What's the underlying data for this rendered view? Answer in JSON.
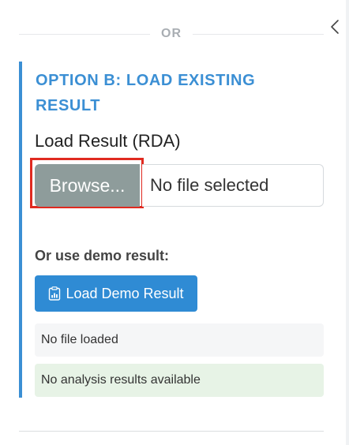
{
  "divider": {
    "text": "OR"
  },
  "option_b": {
    "title": "OPTION B: LOAD EXISTING RESULT",
    "file_field": {
      "label": "Load Result (RDA)",
      "browse_label": "Browse...",
      "value": "No file selected"
    },
    "demo": {
      "label": "Or use demo result:",
      "button_label": "Load Demo Result"
    },
    "status": {
      "file": "No file loaded",
      "analysis": "No analysis results available"
    }
  },
  "icons": {
    "collapse": "chevron-left-icon",
    "demo": "clipboard-chart-icon"
  },
  "colors": {
    "accent": "#3b8fd4",
    "browse_bg": "#8e9c9b",
    "highlight": "#e02a20",
    "demo_bg": "#2f8bd4",
    "success_bg": "#e7f3e6"
  }
}
